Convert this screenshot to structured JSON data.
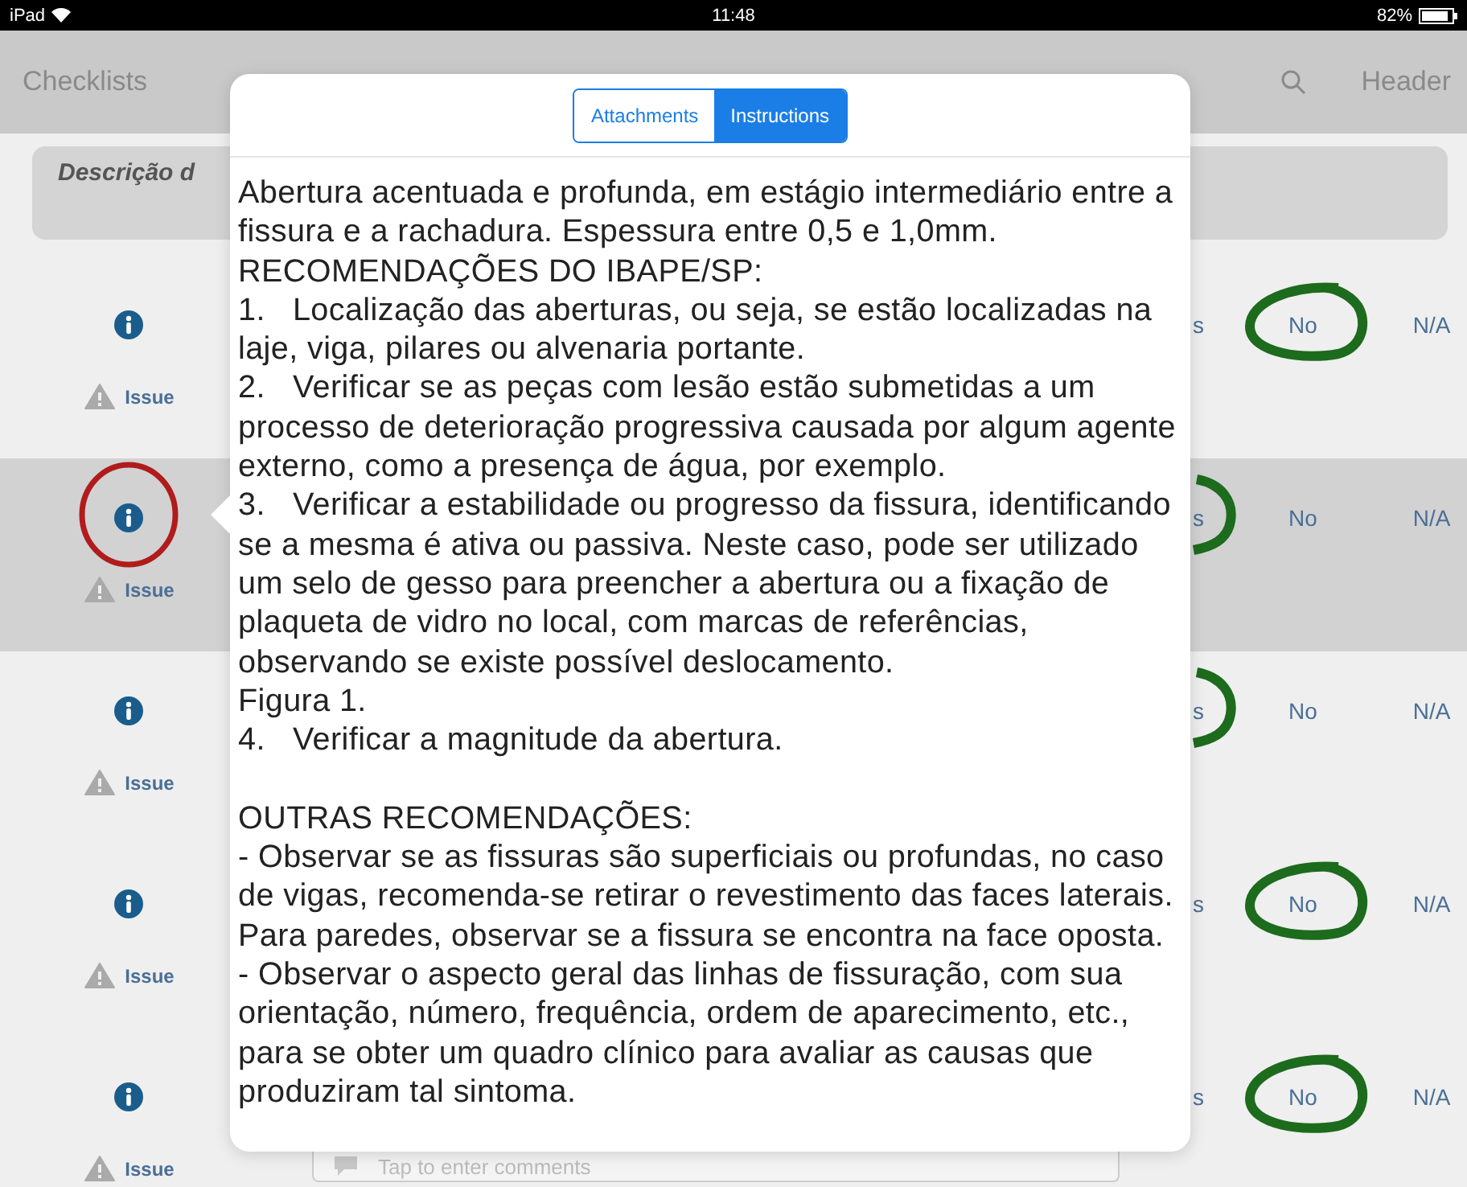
{
  "status_bar": {
    "device": "iPad",
    "time": "11:48",
    "battery": "82%"
  },
  "nav_bar": {
    "back": "Checklists",
    "right": "Header"
  },
  "section_header": "Descrição d",
  "rows": [
    {
      "selected": false,
      "info_marked": false,
      "issue": "Issue",
      "answers": [
        {
          "label": "s",
          "circled": false
        },
        {
          "label": "No",
          "circled": true
        },
        {
          "label": "N/A",
          "circled": false
        }
      ]
    },
    {
      "selected": true,
      "info_marked": true,
      "issue": "Issue",
      "answers": [
        {
          "label": "s",
          "circled": true
        },
        {
          "label": "No",
          "circled": false
        },
        {
          "label": "N/A",
          "circled": false
        }
      ]
    },
    {
      "selected": false,
      "info_marked": false,
      "issue": "Issue",
      "answers": [
        {
          "label": "s",
          "circled": true
        },
        {
          "label": "No",
          "circled": false
        },
        {
          "label": "N/A",
          "circled": false
        }
      ]
    },
    {
      "selected": false,
      "info_marked": false,
      "issue": "Issue",
      "answers": [
        {
          "label": "s",
          "circled": false
        },
        {
          "label": "No",
          "circled": true
        },
        {
          "label": "N/A",
          "circled": false
        }
      ]
    },
    {
      "selected": false,
      "info_marked": false,
      "issue": "Issue",
      "answers": [
        {
          "label": "s",
          "circled": false
        },
        {
          "label": "No",
          "circled": true
        },
        {
          "label": "N/A",
          "circled": false
        }
      ]
    }
  ],
  "comment_field": {
    "placeholder": "Tap to enter comments"
  },
  "popover": {
    "tabs": [
      {
        "label": "Attachments",
        "selected": false
      },
      {
        "label": "Instructions",
        "selected": true
      }
    ],
    "sections": [
      [
        "Abertura acentuada e profunda, em estágio intermediário entre a fissura e a rachadura. Espessura entre 0,5 e 1,0mm.",
        "RECOMENDAÇÕES DO IBAPE/SP:",
        "1.   Localização das aberturas, ou seja, se estão localizadas na laje, viga, pilares ou alvenaria portante.",
        "2.   Verificar se as peças com lesão estão submetidas a um processo de deterioração progressiva causada por algum agente externo, como a presença de água, por exemplo.",
        "3.   Verificar a estabilidade ou progresso da fissura, identificando se a mesma é ativa ou passiva. Neste caso, pode ser utilizado um selo de gesso para preencher a abertura ou a fixação de plaqueta de vidro no local, com marcas de referências, observando se existe possível deslocamento.",
        "Figura 1.",
        "4.   Verificar a magnitude da abertura."
      ],
      [
        "OUTRAS RECOMENDAÇÕES:",
        "- Observar se as fissuras são superficiais ou profundas, no caso de vigas, recomenda-se retirar o revestimento das faces laterais. Para paredes, observar se a fissura se encontra na face oposta.",
        "- Observar o aspecto geral das linhas de fissuração, com sua orientação, número, frequência, ordem de aparecimento, etc., para se obter um quadro clínico para avaliar as causas que produziram tal sintoma."
      ]
    ]
  }
}
